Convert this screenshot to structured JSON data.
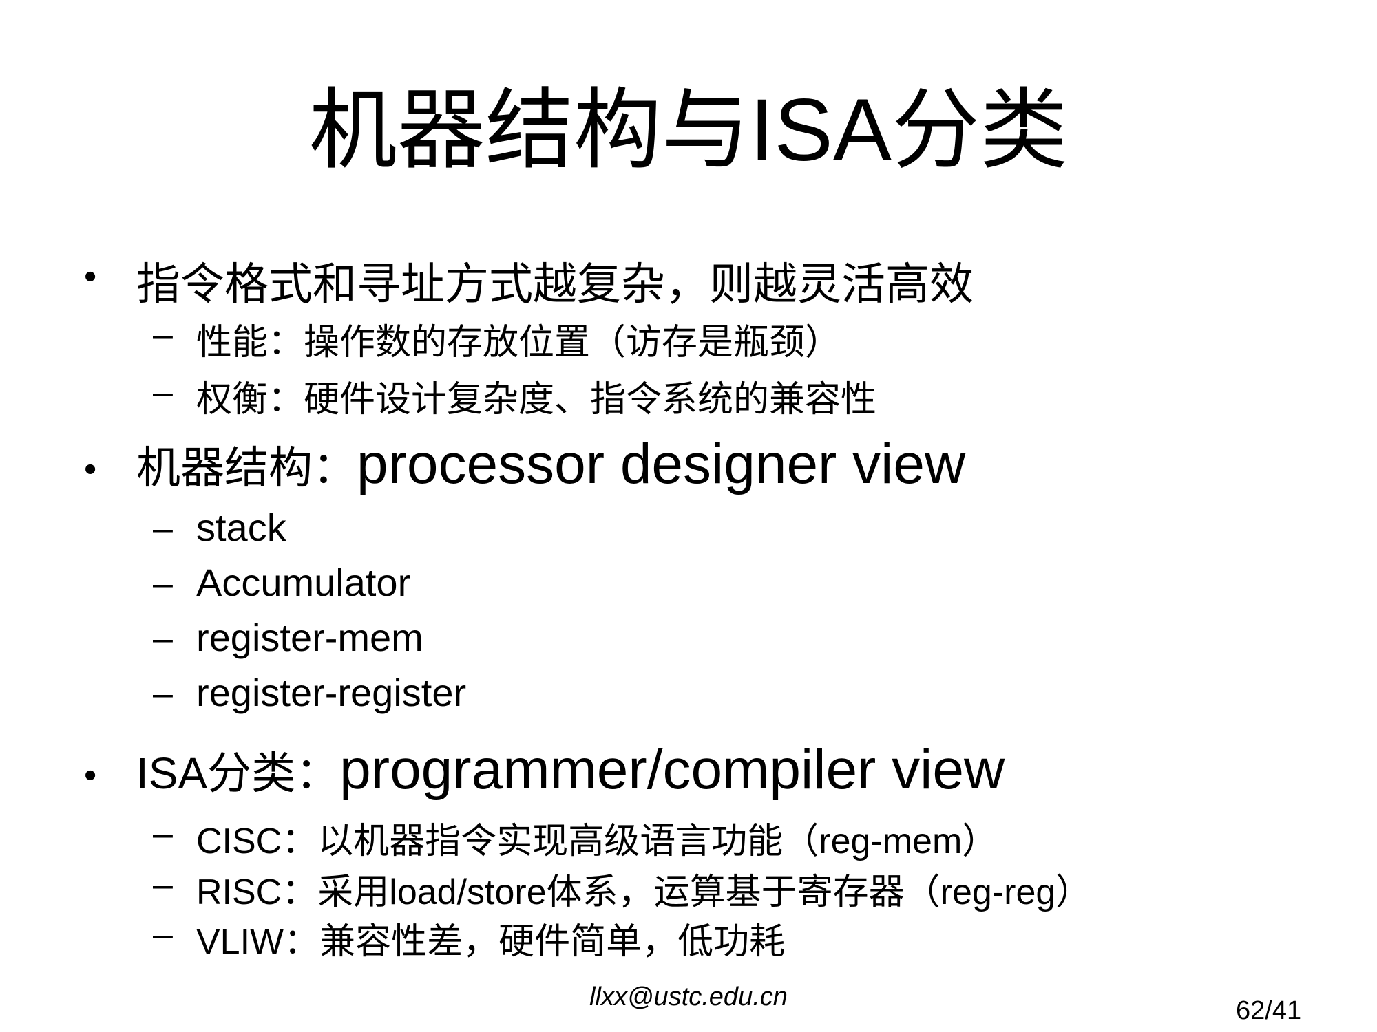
{
  "slide": {
    "title_cn_1": "机器结构与",
    "title_latin": "ISA",
    "title_cn_2": "分类",
    "bullets": [
      {
        "text": "指令格式和寻址方式越复杂，则越灵活高效",
        "subs": [
          {
            "text": "性能：操作数的存放位置（访存是瓶颈）"
          },
          {
            "text": "权衡：硬件设计复杂度、指令系统的兼容性"
          }
        ]
      },
      {
        "prefix": "机器结构：",
        "latin": "processor designer view",
        "subs": [
          {
            "text": "stack"
          },
          {
            "text": "Accumulator"
          },
          {
            "text": "register-mem"
          },
          {
            "text": "register-register"
          }
        ]
      },
      {
        "prefix_latin": "ISA",
        "prefix_cn": "分类：",
        "latin": "programmer/compiler view",
        "subs": [
          {
            "latin_a": "CISC",
            "cn_a": "：以机器指令实现高级语言功能（",
            "latin_b": "reg-mem",
            "cn_b": "）"
          },
          {
            "latin_a": "RISC",
            "cn_a": "：采用",
            "latin_b": "load/store",
            "cn_b": "体系，运算基于寄存器（",
            "latin_c": "reg-reg",
            "cn_c": "）"
          },
          {
            "latin_a": "VLIW",
            "cn_a": "：兼容性差，硬件简单，低功耗"
          }
        ]
      }
    ],
    "bullet_symbol": "•",
    "dash_symbol": "–"
  },
  "footer": {
    "email": "llxx@ustc.edu.cn",
    "page": "62/41"
  }
}
